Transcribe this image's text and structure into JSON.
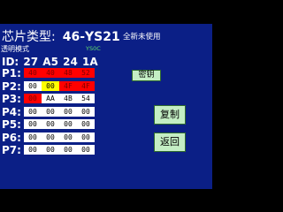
{
  "header": {
    "label": "芯片类型:",
    "chip_type": "46-YS21",
    "status": "全新未使用"
  },
  "mode": "透明模式",
  "small_tag": "YS0C",
  "id_line": "ID: 27 A5 24 1A",
  "pages": [
    {
      "label": "P1:",
      "cells": [
        {
          "text": "40",
          "color": "red"
        },
        {
          "text": "40",
          "color": "red"
        },
        {
          "text": "48",
          "color": "red"
        },
        {
          "text": "52",
          "color": "red"
        }
      ]
    },
    {
      "label": "P2:",
      "cells": [
        {
          "text": "00",
          "color": "white"
        },
        {
          "text": "00",
          "color": "yellow"
        },
        {
          "text": "4F",
          "color": "red"
        },
        {
          "text": "4F",
          "color": "red"
        }
      ]
    },
    {
      "label": "P3:",
      "cells": [
        {
          "text": "00",
          "color": "red"
        },
        {
          "text": "AA",
          "color": "white"
        },
        {
          "text": "4B",
          "color": "white"
        },
        {
          "text": "54",
          "color": "white"
        }
      ]
    },
    {
      "label": "P4:",
      "cells": [
        {
          "text": "00",
          "color": "white"
        },
        {
          "text": "00",
          "color": "white"
        },
        {
          "text": "00",
          "color": "white"
        },
        {
          "text": "00",
          "color": "white"
        }
      ]
    },
    {
      "label": "P5:",
      "cells": [
        {
          "text": "00",
          "color": "white"
        },
        {
          "text": "00",
          "color": "white"
        },
        {
          "text": "00",
          "color": "white"
        },
        {
          "text": "00",
          "color": "white"
        }
      ]
    },
    {
      "label": "P6:",
      "cells": [
        {
          "text": "00",
          "color": "white"
        },
        {
          "text": "00",
          "color": "white"
        },
        {
          "text": "00",
          "color": "white"
        },
        {
          "text": "00",
          "color": "white"
        }
      ]
    },
    {
      "label": "P7:",
      "cells": [
        {
          "text": "00",
          "color": "white"
        },
        {
          "text": "00",
          "color": "white"
        },
        {
          "text": "00",
          "color": "white"
        },
        {
          "text": "00",
          "color": "white"
        }
      ]
    }
  ],
  "buttons": {
    "key": "密钥",
    "copy": "复制",
    "back": "返回"
  },
  "colors": {
    "background": "#0b1f86",
    "red_cell": "#ff0000",
    "yellow_cell": "#ffff00",
    "white_cell": "#ffffff",
    "button": "#c4eec4"
  }
}
